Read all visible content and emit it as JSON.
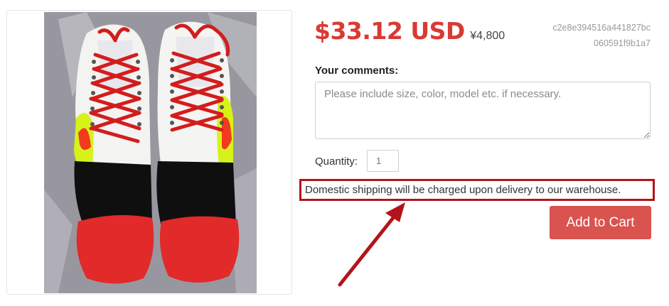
{
  "product": {
    "price_usd": "$33.12 USD",
    "price_jpy": "¥4,800",
    "item_id": "c2e8e394516a441827bc060591f9b1a7",
    "image_name": "red-shoes-photo"
  },
  "comments": {
    "label": "Your comments:",
    "placeholder": "Please include size, color, model etc. if necessary."
  },
  "quantity": {
    "label": "Quantity:",
    "value": "1"
  },
  "shipping_note": "Domestic shipping will be charged upon delivery to our warehouse.",
  "add_to_cart_label": "Add to Cart",
  "colors": {
    "price_red": "#d93a34",
    "button_red": "#d9534f",
    "annotation_red": "#b3141b"
  }
}
